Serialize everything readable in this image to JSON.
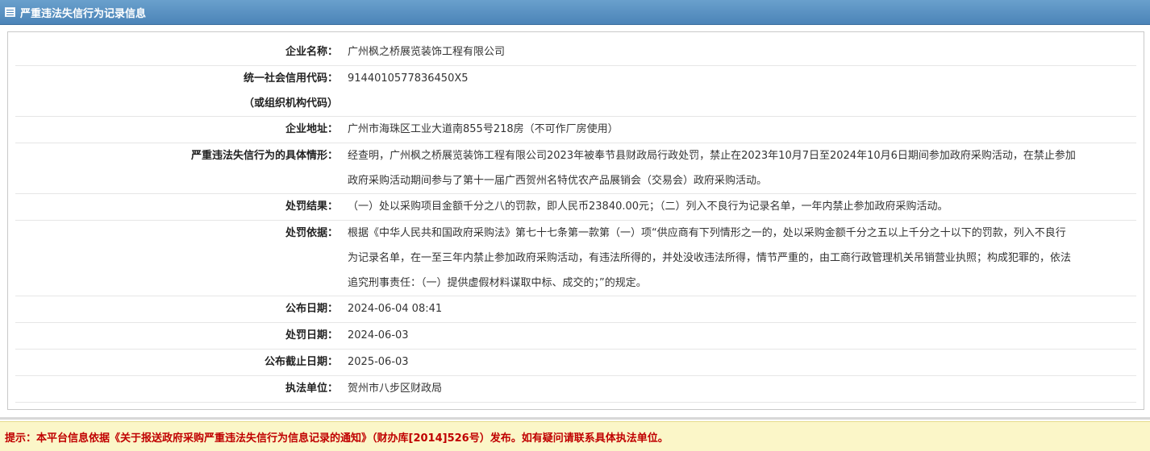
{
  "header": {
    "title": "严重违法失信行为记录信息",
    "icon": "table-icon"
  },
  "rows": [
    {
      "label": "企业名称：",
      "value": "广州枫之桥展览装饰工程有限公司"
    },
    {
      "label": "统一社会信用代码：",
      "label2": "（或组织机构代码）",
      "value": "9144010577836450X5"
    },
    {
      "label": "企业地址：",
      "value": "广州市海珠区工业大道南855号218房（不可作厂房使用）"
    },
    {
      "label": "严重违法失信行为的具体情形：",
      "value_lines": [
        "经查明，广州枫之桥展览装饰工程有限公司2023年被奉节县财政局行政处罚，禁止在2023年10月7日至2024年10月6日期间参加政府采购活动，在禁止参加",
        "政府采购活动期间参与了第十一届广西贺州名特优农产品展销会（交易会）政府采购活动。"
      ]
    },
    {
      "label": "处罚结果：",
      "value": "（一）处以采购项目金额千分之八的罚款，即人民币23840.00元；（二）列入不良行为记录名单，一年内禁止参加政府采购活动。"
    },
    {
      "label": "处罚依据：",
      "value_lines": [
        "根据《中华人民共和国政府采购法》第七十七条第一款第（一）项“供应商有下列情形之一的，处以采购金额千分之五以上千分之十以下的罚款，列入不良行",
        "为记录名单，在一至三年内禁止参加政府采购活动，有违法所得的，并处没收违法所得，情节严重的，由工商行政管理机关吊销营业执照；构成犯罪的，依法",
        "追究刑事责任：（一）提供虚假材料谋取中标、成交的；”的规定。"
      ]
    },
    {
      "label": "公布日期：",
      "value": "2024-06-04 08:41"
    },
    {
      "label": "处罚日期：",
      "value": "2024-06-03"
    },
    {
      "label": "公布截止日期：",
      "value": "2025-06-03"
    },
    {
      "label": "执法单位：",
      "value": "贺州市八步区财政局"
    }
  ],
  "footer": {
    "notice": "提示：本平台信息依据《关于报送政府采购严重违法失信行为信息记录的通知》（财办库[2014]526号）发布。如有疑问请联系具体执法单位。"
  },
  "colors": {
    "header_bg": "#5590c2",
    "notice_bg": "#fbf6c8",
    "notice_text": "#c00000"
  }
}
